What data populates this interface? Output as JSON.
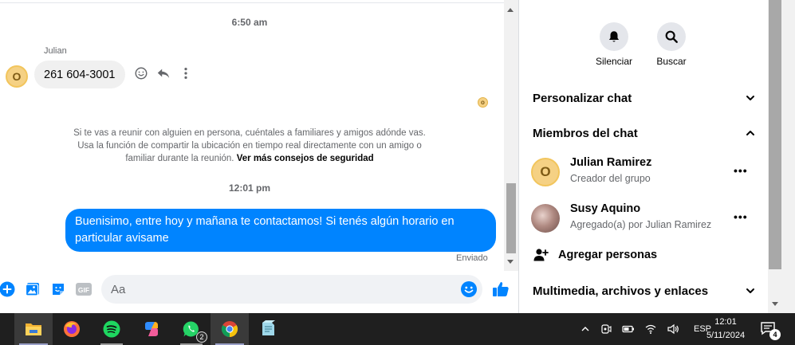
{
  "chat": {
    "timestamp_1": "6:50 am",
    "sender": "Julian",
    "avatar_initial": "O",
    "incoming_message": "261 604-3001",
    "read_receipt_initial": "o",
    "safety_text": "Si te vas a reunir con alguien en persona, cuéntales a familiares y amigos adónde vas. Usa la función de compartir la ubicación en tiempo real directamente con un amigo o familiar durante la reunión.",
    "safety_link": "Ver más consejos de seguridad",
    "timestamp_2": "12:01 pm",
    "outgoing_message": "Buenisimo, entre hoy y mañana te contactamos! Si tenés algún horario en particular avisame",
    "sent_status": "Enviado",
    "composer_placeholder": "Aa",
    "accent_color": "#0084ff"
  },
  "info_panel": {
    "mute_label": "Silenciar",
    "search_label": "Buscar",
    "customize_chat": "Personalizar chat",
    "chat_members": "Miembros del chat",
    "members": [
      {
        "initial": "O",
        "name": "Julian Ramirez",
        "role": "Creador del grupo"
      },
      {
        "name": "Susy Aquino",
        "role": "Agregado(a) por Julian Ramirez"
      }
    ],
    "add_people": "Agregar personas",
    "media_files_links": "Multimedia, archivos y enlaces"
  },
  "taskbar": {
    "apps": [
      "file-explorer",
      "firefox",
      "spotify",
      "copilot",
      "whatsapp",
      "chrome",
      "notepad"
    ],
    "whatsapp_badge": "2",
    "language": "ESP",
    "time": "12:01",
    "date": "5/11/2024",
    "notifications_badge": "4"
  }
}
